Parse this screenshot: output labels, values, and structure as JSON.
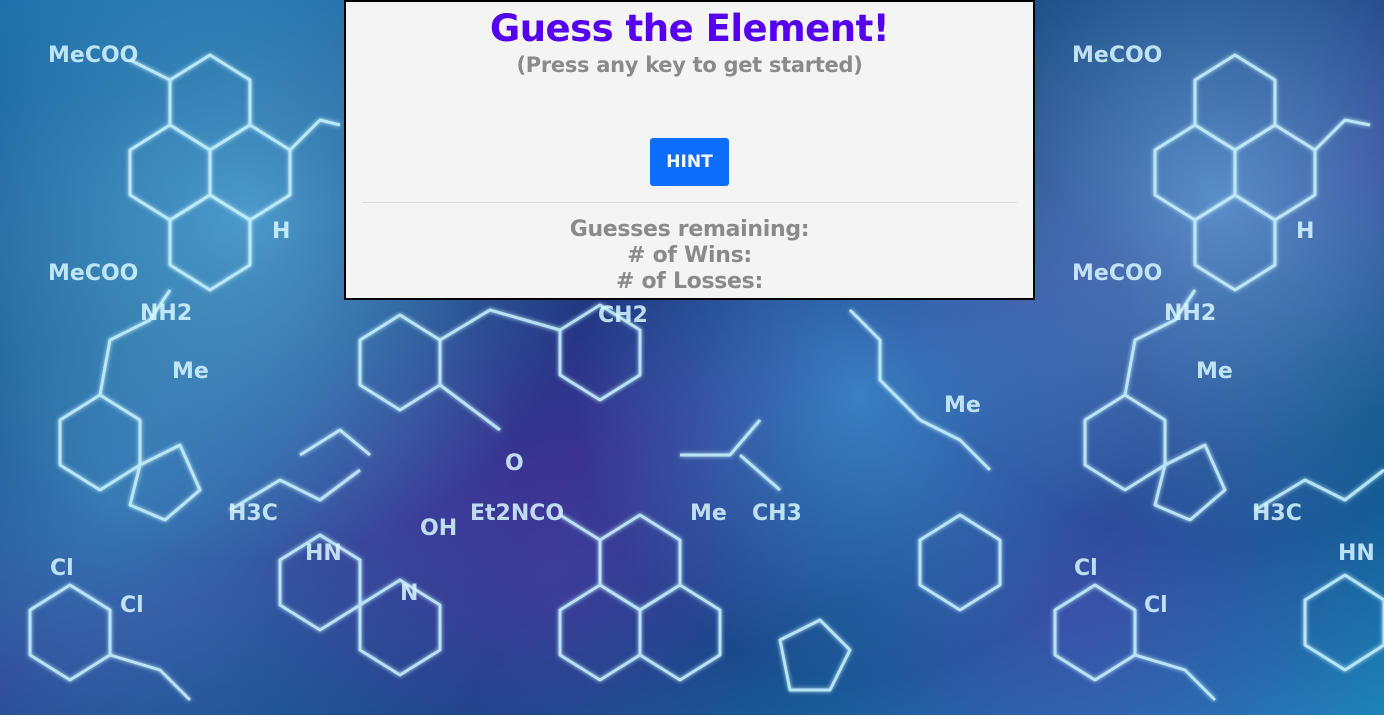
{
  "game": {
    "title": "Guess the Element!",
    "subtitle": "(Press any key to get started)",
    "current_word": "",
    "hint_label": "HINT"
  },
  "stats": {
    "guesses_remaining_label": "Guesses remaining:",
    "wins_label": "# of Wins:",
    "losses_label": "# of Losses:"
  },
  "colors": {
    "title": "#5500ee",
    "muted_text": "#8a8a8a",
    "hint_button_bg": "#0d6efd",
    "panel_bg": "#f4f4f4"
  },
  "background": {
    "formula_labels": [
      "MeCOO",
      "MeCOO",
      "H",
      "NH2",
      "Me",
      "CH2",
      "O",
      "H3C",
      "Et2NCO",
      "Me",
      "CH3",
      "Me",
      "OH",
      "HN",
      "Cl",
      "Cl",
      "N",
      "MeCOO",
      "MeCOO",
      "H",
      "NH2",
      "Me",
      "H3C",
      "Cl",
      "Cl",
      "HN"
    ]
  }
}
